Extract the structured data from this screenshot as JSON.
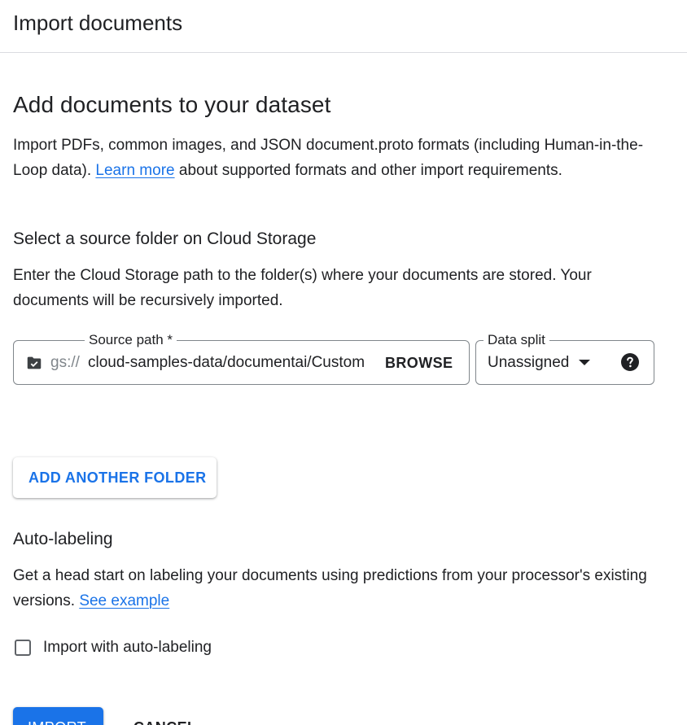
{
  "dialog": {
    "title": "Import documents"
  },
  "intro": {
    "heading": "Add documents to your dataset",
    "text_before_link": "Import PDFs, common images, and JSON document.proto formats (including Human-in-the-Loop data). ",
    "link": "Learn more",
    "text_after_link": " about supported formats and other import requirements."
  },
  "source": {
    "heading": "Select a source folder on Cloud Storage",
    "description": "Enter the Cloud Storage path to the folder(s) where your documents are stored. Your documents will be recursively imported.",
    "path_label": "Source path *",
    "path_prefix": "gs://",
    "path_value": "cloud-samples-data/documentai/Custom",
    "browse_label": "BROWSE",
    "folder_icon": "folder-check-icon",
    "split_label": "Data split",
    "split_value": "Unassigned",
    "help_icon": "help-icon",
    "add_folder_label": "ADD ANOTHER FOLDER"
  },
  "auto_labeling": {
    "heading": "Auto-labeling",
    "text_before_link": "Get a head start on labeling your documents using predictions from your processor's existing versions. ",
    "link": "See example",
    "checkbox_label": "Import with auto-labeling",
    "checked": false
  },
  "actions": {
    "import_label": "IMPORT",
    "cancel_label": "CANCEL"
  },
  "colors": {
    "accent": "#1a73e8",
    "text": "#202124",
    "border": "#80868b",
    "divider": "#dadce0"
  }
}
